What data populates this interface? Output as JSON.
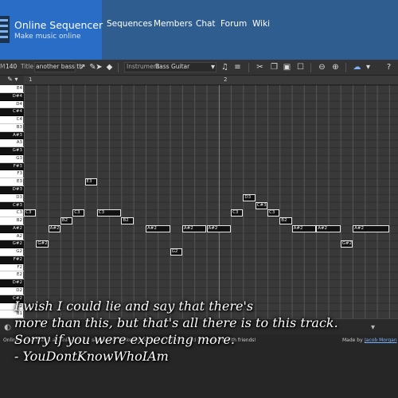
{
  "header": {
    "brand_title": "Online Sequencer",
    "brand_subtitle": "Make music online",
    "nav": [
      {
        "label": "Sequences"
      },
      {
        "label": "Members"
      },
      {
        "label": "Chat"
      },
      {
        "label": "Forum"
      },
      {
        "label": "Wiki"
      }
    ]
  },
  "toolbar": {
    "bpm_label": "M",
    "bpm_value": "140",
    "title_label": "Title",
    "title_value": "another bass th",
    "instrument_label": "Instrument",
    "instrument_value": "Bass Guitar"
  },
  "ruler": {
    "bars": [
      "1",
      "2"
    ]
  },
  "piano_keys": [
    {
      "label": "E4",
      "black": false
    },
    {
      "label": "D#4",
      "black": true
    },
    {
      "label": "D4",
      "black": false
    },
    {
      "label": "C#4",
      "black": true
    },
    {
      "label": "C4",
      "black": false
    },
    {
      "label": "B3",
      "black": false
    },
    {
      "label": "A#3",
      "black": true
    },
    {
      "label": "A3",
      "black": false
    },
    {
      "label": "G#3",
      "black": true
    },
    {
      "label": "G3",
      "black": false
    },
    {
      "label": "F#3",
      "black": true
    },
    {
      "label": "F3",
      "black": false
    },
    {
      "label": "E3",
      "black": false
    },
    {
      "label": "D#3",
      "black": true
    },
    {
      "label": "D3",
      "black": false
    },
    {
      "label": "C#3",
      "black": true
    },
    {
      "label": "C3",
      "black": false
    },
    {
      "label": "B2",
      "black": false
    },
    {
      "label": "A#2",
      "black": true
    },
    {
      "label": "A2",
      "black": false
    },
    {
      "label": "G#2",
      "black": true
    },
    {
      "label": "G2",
      "black": false
    },
    {
      "label": "F#2",
      "black": true
    },
    {
      "label": "F2",
      "black": false
    },
    {
      "label": "E2",
      "black": false
    },
    {
      "label": "D#2",
      "black": true
    },
    {
      "label": "D2",
      "black": false
    },
    {
      "label": "C#2",
      "black": true
    },
    {
      "label": "C2",
      "black": false
    },
    {
      "label": "B1",
      "black": false
    }
  ],
  "notes": [
    {
      "label": "C3",
      "step": 0,
      "len": 1
    },
    {
      "label": "G#2",
      "step": 1,
      "len": 1
    },
    {
      "label": "A#2",
      "step": 2,
      "len": 1
    },
    {
      "label": "B2",
      "step": 3,
      "len": 1
    },
    {
      "label": "C3",
      "step": 4,
      "len": 1
    },
    {
      "label": "E3",
      "step": 5,
      "len": 1
    },
    {
      "label": "C3",
      "step": 6,
      "len": 2
    },
    {
      "label": "B2",
      "step": 8,
      "len": 1
    },
    {
      "label": "A#2",
      "step": 10,
      "len": 2
    },
    {
      "label": "G2",
      "step": 12,
      "len": 1
    },
    {
      "label": "A#2",
      "step": 13,
      "len": 2
    },
    {
      "label": "A#2",
      "step": 15,
      "len": 2
    },
    {
      "label": "C3",
      "step": 17,
      "len": 1
    },
    {
      "label": "D3",
      "step": 18,
      "len": 1
    },
    {
      "label": "C#3",
      "step": 19,
      "len": 1
    },
    {
      "label": "C3",
      "step": 20,
      "len": 1
    },
    {
      "label": "B2",
      "step": 21,
      "len": 1
    },
    {
      "label": "A#2",
      "step": 22,
      "len": 2
    },
    {
      "label": "A#2",
      "step": 24,
      "len": 2
    },
    {
      "label": "G#2",
      "step": 26,
      "len": 1
    },
    {
      "label": "A#2",
      "step": 27,
      "len": 3
    }
  ],
  "footer": {
    "description": "Online Sequencer is an online music sequencer. Make tunes in your browser and share them with friends!",
    "made_by": "Made by",
    "author": "Jacob Morgan"
  },
  "caption_lines": [
    "I wish I could lie and say that there's",
    "more than this, but that's all there is to this track.",
    "Sorry if you were expecting more.",
    "- YouDontKnowWhoIAm"
  ],
  "colors": {
    "brand": "#2a6dc7",
    "header": "#2f5d8f",
    "grid": "#393939",
    "note": "#111111"
  }
}
